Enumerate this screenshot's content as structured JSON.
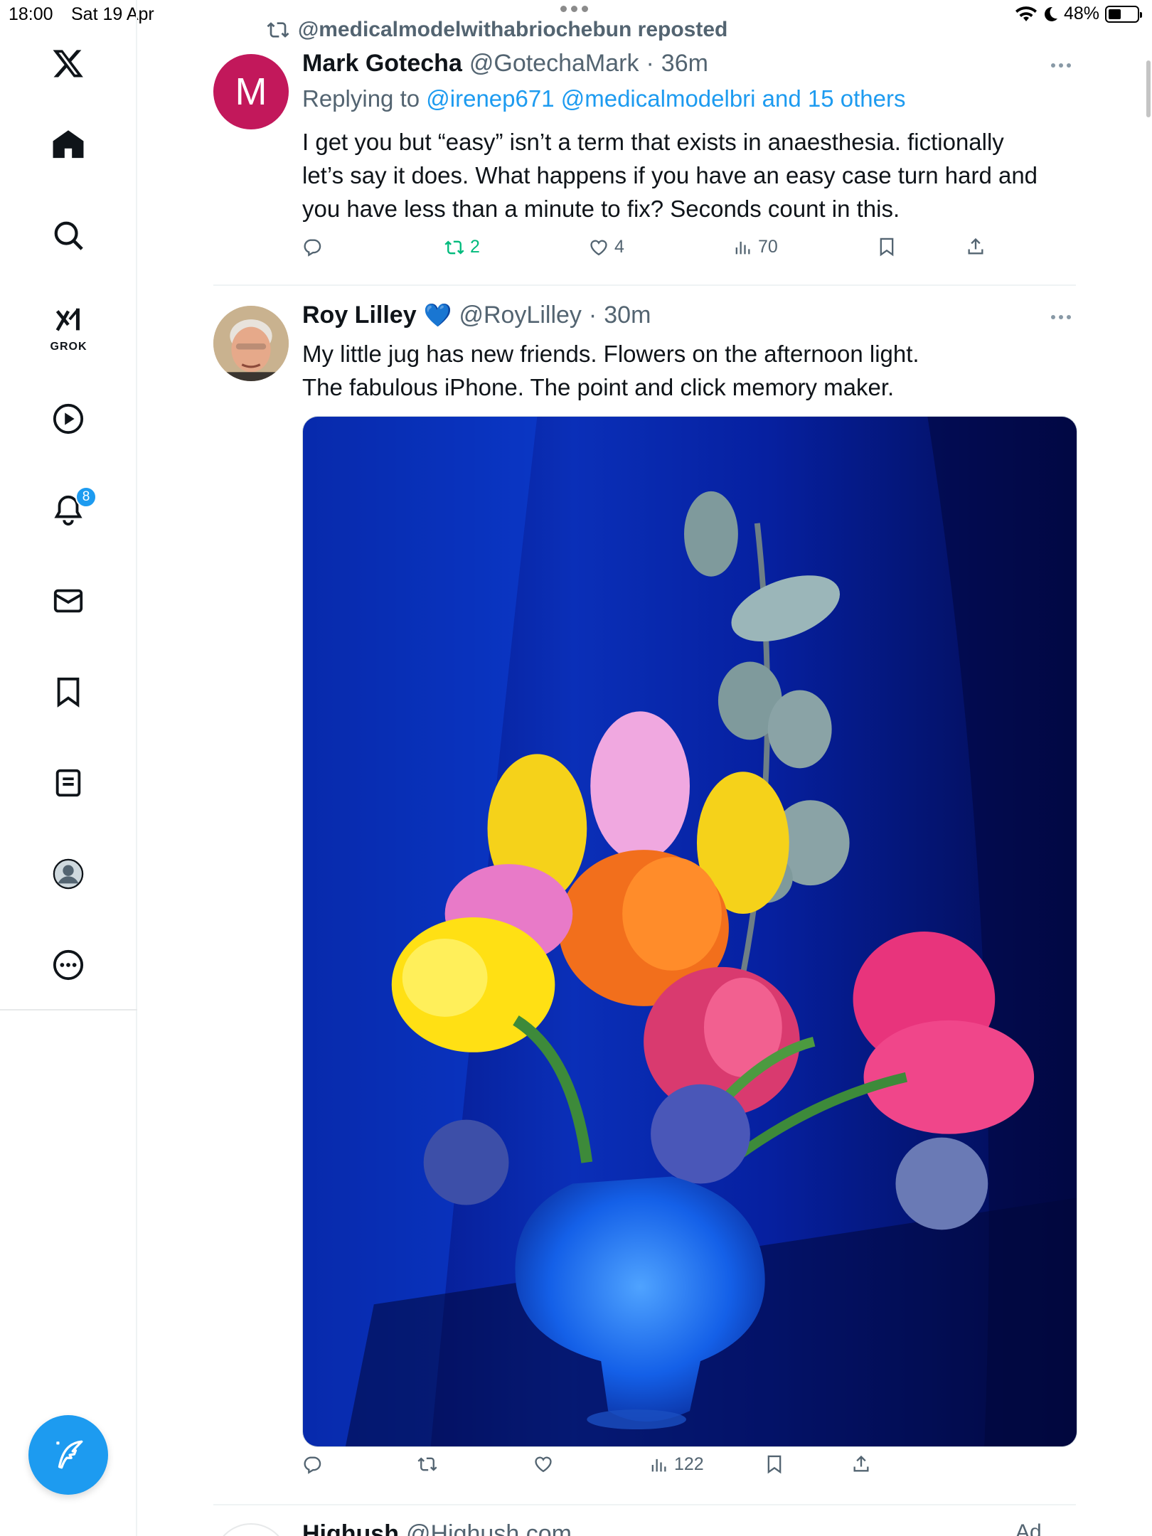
{
  "status_bar": {
    "time": "18:00",
    "date": "Sat 19 Apr",
    "battery": "48%"
  },
  "sidebar": {
    "items": [
      {
        "name": "home",
        "icon": "home-icon"
      },
      {
        "name": "explore",
        "icon": "search-icon"
      },
      {
        "name": "grok",
        "icon": "grok-icon",
        "label": "GROK"
      },
      {
        "name": "video",
        "icon": "play-icon"
      },
      {
        "name": "notifications",
        "icon": "bell-icon",
        "badge": "8"
      },
      {
        "name": "messages",
        "icon": "mail-icon"
      },
      {
        "name": "bookmarks",
        "icon": "bookmark-icon"
      },
      {
        "name": "lists",
        "icon": "list-icon"
      },
      {
        "name": "profile",
        "icon": "profile-icon"
      },
      {
        "name": "more",
        "icon": "more-icon"
      }
    ],
    "logo": "X"
  },
  "feed": {
    "repost_banner": "@medicalmodelwithabriochebun reposted",
    "tweets": [
      {
        "avatar_letter": "M",
        "display_name": "Mark Gotecha",
        "handle": "@GotechaMark",
        "dot": "·",
        "time": "36m",
        "replying_prefix": "Replying to",
        "replying_links": "@irenep671 @medicalmodelbri and 15 others",
        "text": "I get you but “easy” isn’t a term that exists in anaesthesia. fictionally\nlet’s say it does. What happens if you have an easy case turn hard and\nyou have less than a minute to fix? Seconds count in this.",
        "retweets": "2",
        "likes": "4",
        "views": "70"
      },
      {
        "display_name": "Roy Lilley",
        "verified_emoji": "💙",
        "handle": "@RoyLilley",
        "dot": "·",
        "time": "30m",
        "text": "My little jug has new friends. Flowers on the afternoon light.\nThe fabulous iPhone. The point and click memory maker.",
        "views": "122"
      }
    ],
    "next_tweet": {
      "display_name": "Highush",
      "handle": "@Highush.com",
      "ad_label": "Ad"
    }
  },
  "colors": {
    "accent": "#1d9bf0",
    "retweet_green": "#00ba7c",
    "muted": "#536471",
    "avatar_m": "#c2185b"
  }
}
